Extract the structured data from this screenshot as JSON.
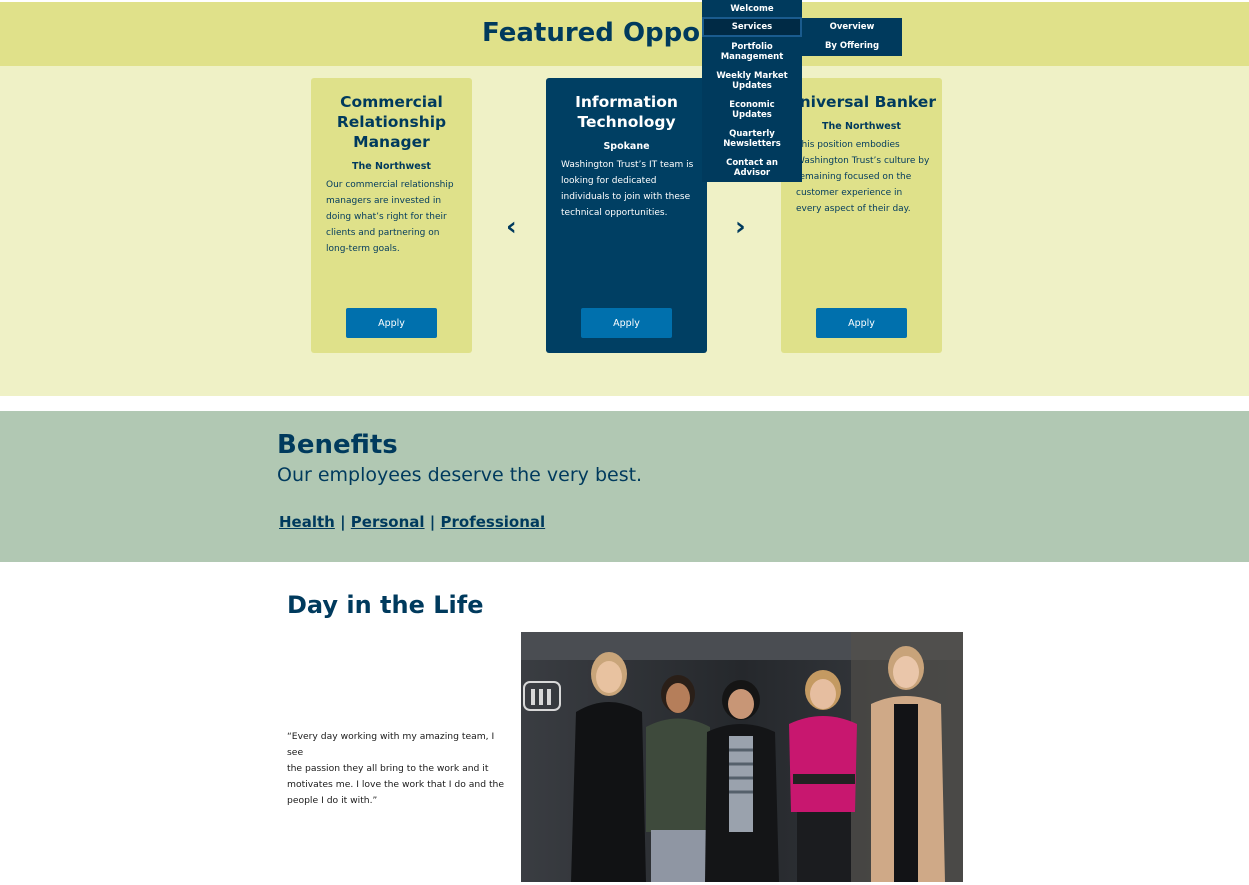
{
  "featured": {
    "title": "Featured Opportu",
    "cards": [
      {
        "title_lines": [
          "Commercial",
          "Relationship",
          "Manager"
        ],
        "location": "The Northwest",
        "description_lines": [
          "Our commercial relationship",
          "managers are invested in",
          "doing what’s right for their",
          "clients and partnering on",
          "long-term goals."
        ],
        "apply_label": "Apply"
      },
      {
        "title_lines": [
          "Information",
          "Technology"
        ],
        "location": "Spokane",
        "description_lines": [
          "Washington Trust’s IT team is",
          "looking for dedicated",
          "individuals to join with these",
          "technical opportunities."
        ],
        "apply_label": "Apply"
      },
      {
        "title_lines": [
          "Universal Banker"
        ],
        "location": "The Northwest",
        "description_lines": [
          "This position embodies",
          "Washington Trust’s culture by",
          "remaining focused on the",
          "customer experience in",
          "every aspect of their day."
        ],
        "apply_label": "Apply"
      }
    ],
    "prev_arrow": "‹",
    "next_arrow": "›"
  },
  "menu": {
    "items": [
      {
        "lines": [
          "Welcome"
        ]
      },
      {
        "lines": [
          "Services"
        ]
      },
      {
        "lines": [
          "Portfolio",
          "Management"
        ]
      },
      {
        "lines": [
          "Weekly Market",
          "Updates"
        ]
      },
      {
        "lines": [
          "Economic",
          "Updates"
        ]
      },
      {
        "lines": [
          "Quarterly",
          "Newsletters"
        ]
      },
      {
        "lines": [
          "Contact an",
          "Advisor"
        ]
      }
    ],
    "submenu": [
      "Overview",
      "By Offering"
    ]
  },
  "benefits": {
    "title": "Benefits",
    "subtitle": "Our employees deserve the very best.",
    "links": [
      "Health",
      "Personal",
      "Professional"
    ],
    "separator": "|"
  },
  "day_in_life": {
    "title": "Day in the Life",
    "quote_lines": [
      "“Every day working with my amazing team, I see",
      "the passion they all bring to the work and it",
      "motivates me. I love the work that I do and the",
      "people I do it with.”"
    ]
  },
  "colors": {
    "navy": "#003a5d",
    "olive_band": "#e0e18a",
    "pale_band": "#eff1c6",
    "sage": "#b1c8b3",
    "button_blue": "#0070ad"
  }
}
